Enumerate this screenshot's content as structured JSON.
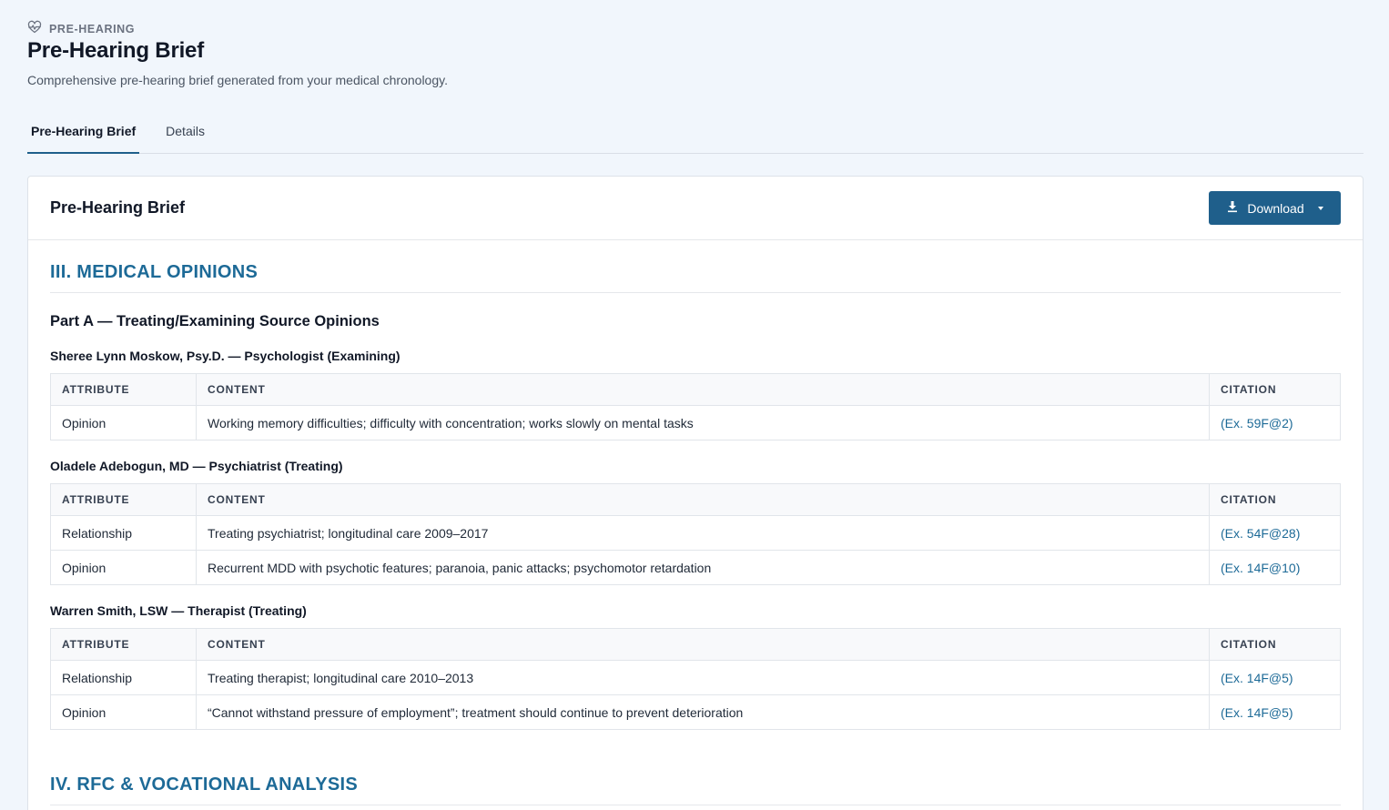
{
  "eyebrow": {
    "label": "PRE-HEARING",
    "icon": "heart-pulse-icon"
  },
  "page": {
    "title": "Pre-Hearing Brief",
    "subtitle": "Comprehensive pre-hearing brief generated from your medical chronology."
  },
  "tabs": [
    {
      "label": "Pre-Hearing Brief",
      "active": true
    },
    {
      "label": "Details",
      "active": false
    }
  ],
  "card": {
    "title": "Pre-Hearing Brief",
    "download_label": "Download",
    "accent_color": "#1f5f8b"
  },
  "sections": {
    "medical_opinions": "III. MEDICAL OPINIONS",
    "part_a": "Part A — Treating/Examining Source Opinions",
    "rfc": "IV. RFC & VOCATIONAL ANALYSIS"
  },
  "table_headers": {
    "attribute": "ATTRIBUTE",
    "content": "CONTENT",
    "citation": "CITATION"
  },
  "sources": [
    {
      "heading": "Sheree Lynn Moskow, Psy.D. — Psychologist (Examining)",
      "rows": [
        {
          "attribute": "Opinion",
          "content": "Working memory difficulties; difficulty with concentration; works slowly on mental tasks",
          "citation": "(Ex. 59F@2)"
        }
      ]
    },
    {
      "heading": "Oladele Adebogun, MD — Psychiatrist (Treating)",
      "rows": [
        {
          "attribute": "Relationship",
          "content": "Treating psychiatrist; longitudinal care 2009–2017",
          "citation": "(Ex. 54F@28)"
        },
        {
          "attribute": "Opinion",
          "content": "Recurrent MDD with psychotic features; paranoia, panic attacks; psychomotor retardation",
          "citation": "(Ex. 14F@10)"
        }
      ]
    },
    {
      "heading": "Warren Smith, LSW — Therapist (Treating)",
      "rows": [
        {
          "attribute": "Relationship",
          "content": "Treating therapist; longitudinal care 2010–2013",
          "citation": "(Ex. 14F@5)"
        },
        {
          "attribute": "Opinion",
          "content": "“Cannot withstand pressure of employment”; treatment should continue to prevent deterioration",
          "citation": "(Ex. 14F@5)"
        }
      ]
    }
  ]
}
